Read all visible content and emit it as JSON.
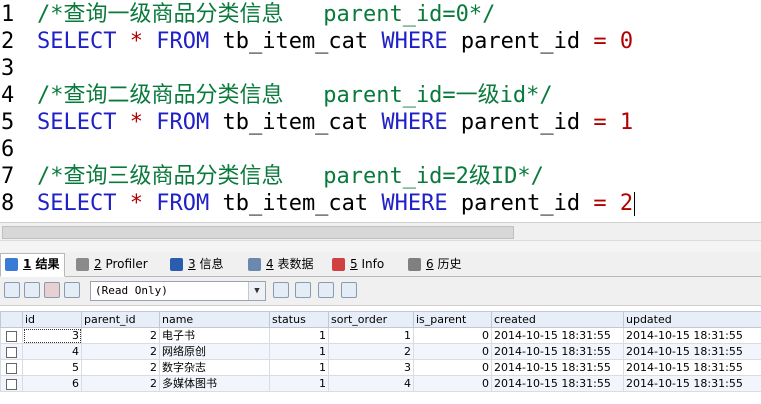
{
  "editor": {
    "lines": [
      {
        "num": "1",
        "comment": "/*查询一级商品分类信息   parent_id=0*/"
      },
      {
        "num": "2",
        "select": "SELECT",
        "star": "*",
        "from": "FROM",
        "table": "tb_item_cat",
        "where": "WHERE",
        "column": "parent_id",
        "eq": "=",
        "value": "0"
      },
      {
        "num": "3"
      },
      {
        "num": "4",
        "comment": "/*查询二级商品分类信息   parent_id=一级id*/"
      },
      {
        "num": "5",
        "select": "SELECT",
        "star": "*",
        "from": "FROM",
        "table": "tb_item_cat",
        "where": "WHERE",
        "column": "parent_id",
        "eq": "=",
        "value": "1"
      },
      {
        "num": "6"
      },
      {
        "num": "7",
        "comment": "/*查询三级商品分类信息   parent_id=2级ID*/"
      },
      {
        "num": "8",
        "select": "SELECT",
        "star": "*",
        "from": "FROM",
        "table": "tb_item_cat",
        "where": "WHERE",
        "column": "parent_id",
        "eq": "=",
        "value": "2"
      }
    ]
  },
  "tabs": [
    {
      "key": "1",
      "label": " 结果",
      "icon": "result-grid-icon",
      "color": "#3a7bd5"
    },
    {
      "key": "2",
      "label": " Profiler",
      "icon": "profiler-icon",
      "color": "#8a8a8a"
    },
    {
      "key": "3",
      "label": " 信息",
      "icon": "info-icon",
      "color": "#2a5db0"
    },
    {
      "key": "4",
      "label": " 表数据",
      "icon": "table-data-icon",
      "color": "#6a88b0"
    },
    {
      "key": "5",
      "label": " Info",
      "icon": "info-dots-icon",
      "color": "#d04040"
    },
    {
      "key": "6",
      "label": " 历史",
      "icon": "history-calendar-icon",
      "color": "#808080"
    }
  ],
  "toolbar": {
    "mode": "(Read Only)"
  },
  "grid": {
    "columns": [
      "id",
      "parent_id",
      "name",
      "status",
      "sort_order",
      "is_parent",
      "created",
      "updated"
    ],
    "rows": [
      [
        "3",
        "2",
        "电子书",
        "1",
        "1",
        "0",
        "2014-10-15 18:31:55",
        "2014-10-15 18:31:55"
      ],
      [
        "4",
        "2",
        "网络原创",
        "1",
        "2",
        "0",
        "2014-10-15 18:31:55",
        "2014-10-15 18:31:55"
      ],
      [
        "5",
        "2",
        "数字杂志",
        "1",
        "3",
        "0",
        "2014-10-15 18:31:55",
        "2014-10-15 18:31:55"
      ],
      [
        "6",
        "2",
        "多媒体图书",
        "1",
        "4",
        "0",
        "2014-10-15 18:31:55",
        "2014-10-15 18:31:55"
      ]
    ]
  }
}
